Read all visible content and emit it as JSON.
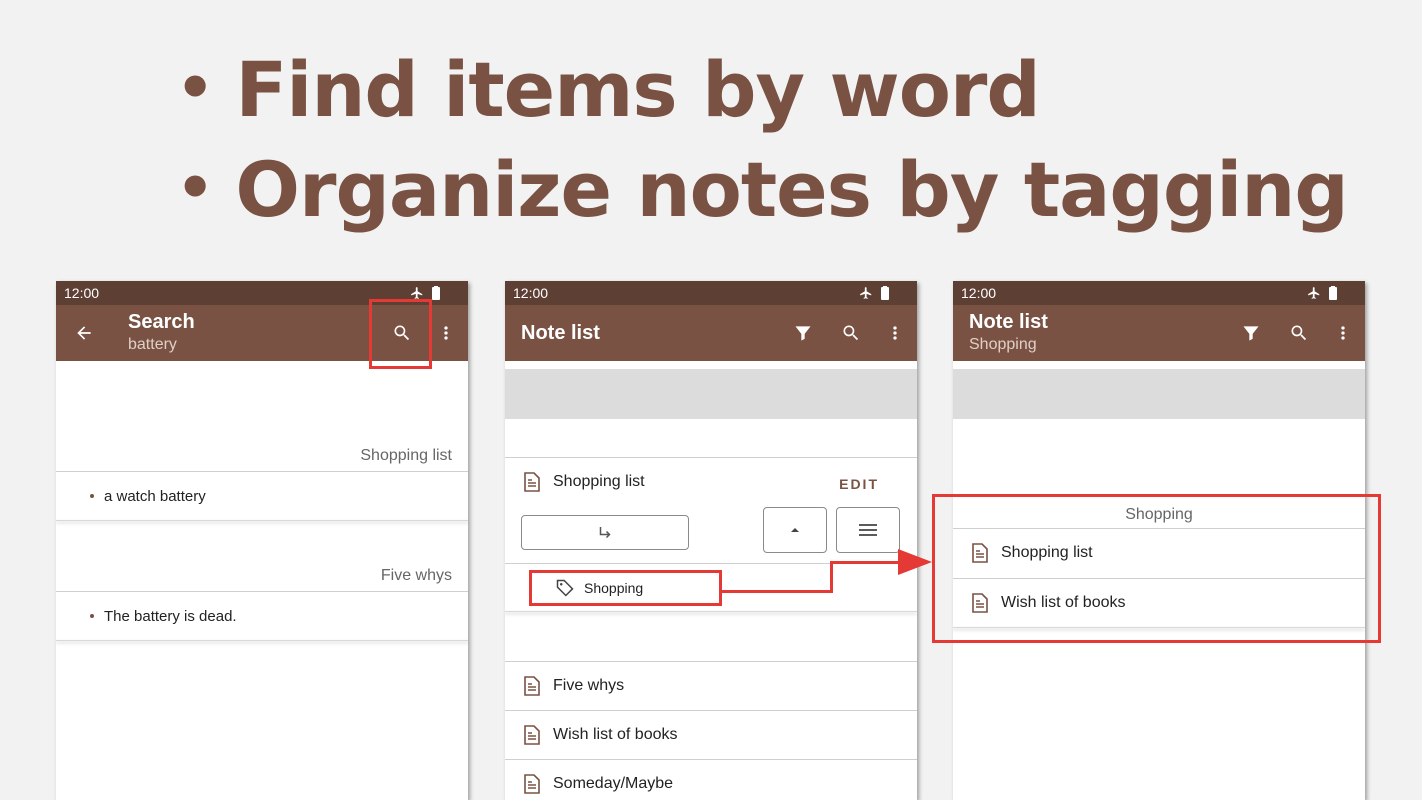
{
  "headline": {
    "bullet": "•",
    "line1": "Find items by word",
    "line2": "Organize notes by tagging"
  },
  "status_time": "12:00",
  "phone1": {
    "title": "Search",
    "subtitle": "battery",
    "groups": [
      {
        "header": "Shopping list",
        "item": "a watch battery"
      },
      {
        "header": "Five whys",
        "item": "The battery is dead."
      }
    ]
  },
  "phone2": {
    "title": "Note list",
    "expanded_note": "Shopping list",
    "edit_label": "EDIT",
    "tag": "Shopping",
    "notes": [
      "Five whys",
      "Wish list of books",
      "Someday/Maybe"
    ]
  },
  "phone3": {
    "title": "Note list",
    "subtitle": "Shopping",
    "group_header": "Shopping",
    "notes": [
      "Shopping list",
      "Wish list of books"
    ]
  },
  "colors": {
    "accent": "#7a5243",
    "status_bar": "#5e3f34",
    "highlight": "#e53935"
  }
}
